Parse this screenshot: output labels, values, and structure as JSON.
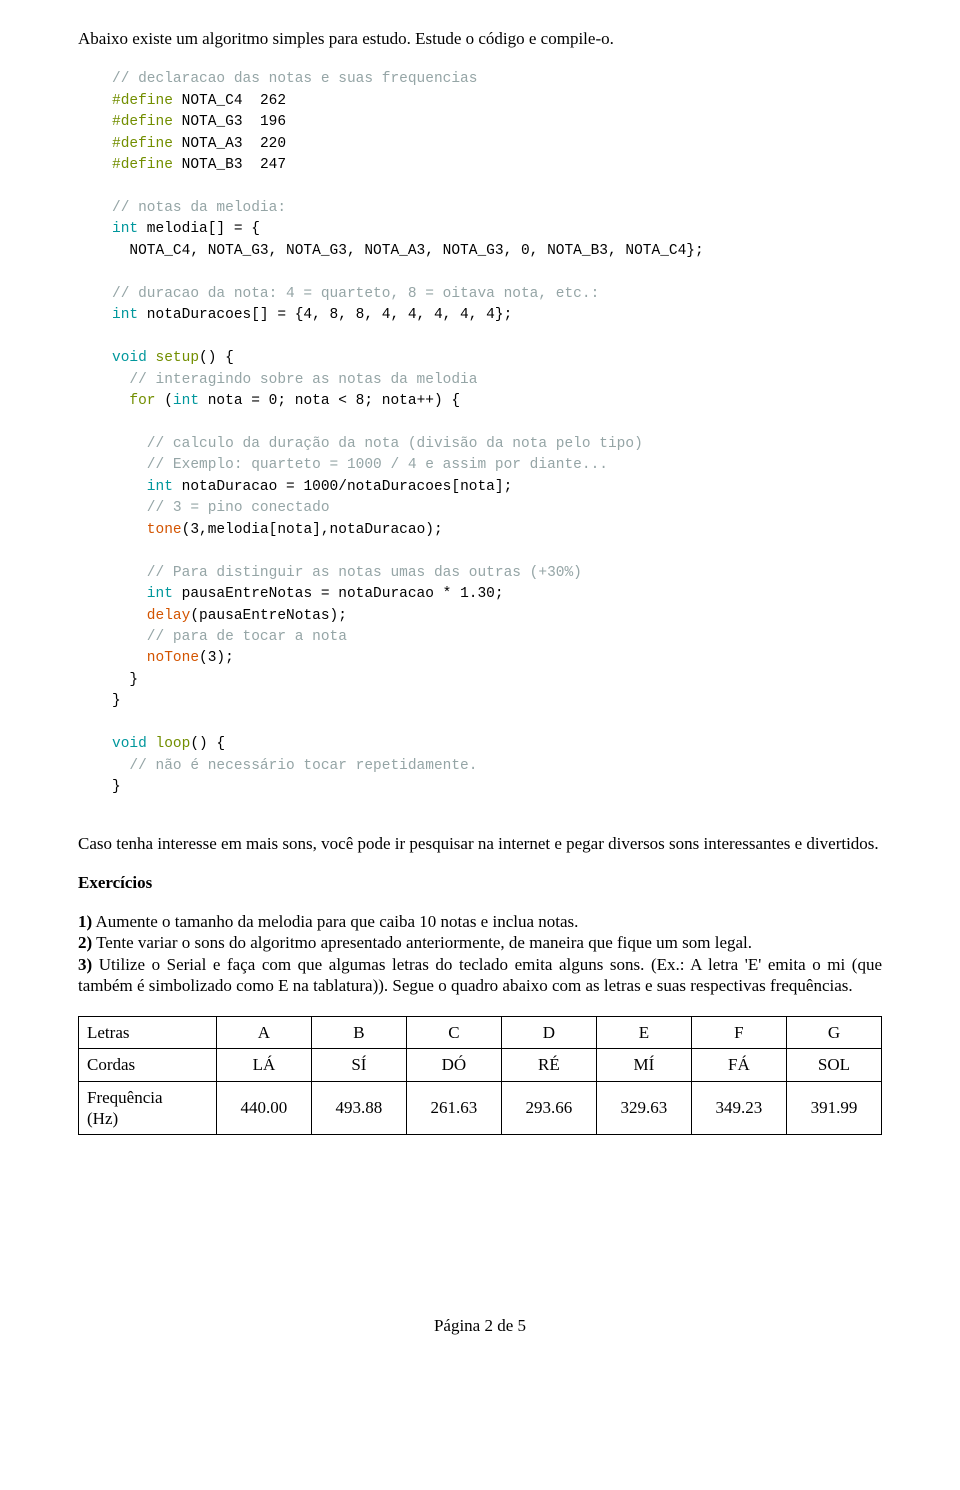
{
  "intro": "Abaixo existe um algoritmo simples para estudo. Estude o código e compile-o.",
  "code": {
    "c1": "// declaracao das notas e suas frequencias",
    "d1a": "#define",
    "d1b": "NOTA_C4  262",
    "d2a": "#define",
    "d2b": "NOTA_G3  196",
    "d3a": "#define",
    "d3b": "NOTA_A3  220",
    "d4a": "#define",
    "d4b": "NOTA_B3  247",
    "c2": "// notas da melodia:",
    "l5a": "int",
    "l5b": " melodia[] = {",
    "l6": "  NOTA_C4, NOTA_G3, NOTA_G3, NOTA_A3, NOTA_G3, 0, NOTA_B3, NOTA_C4};",
    "c3": "// duracao da nota: 4 = quarteto, 8 = oitava nota, etc.:",
    "l7a": "int",
    "l7b": " notaDuracoes[] = {4, 8, 8, 4, 4, 4, 4, 4};",
    "l8a": "void",
    "l8b": "setup",
    "l8c": "() {",
    "c4": "  // interagindo sobre as notas da melodia",
    "l9a": "  for",
    "l9b": " (",
    "l9c": "int",
    "l9d": " nota = 0; nota < 8; nota++) {",
    "c5": "    // calculo da duração da nota (divisão da nota pelo tipo)",
    "c6": "    // Exemplo: quarteto = 1000 / 4 e assim por diante...",
    "l10a": "    int",
    "l10b": " notaDuracao = 1000/notaDuracoes[nota];",
    "c7": "    // 3 = pino conectado",
    "l11a": "    tone",
    "l11b": "(3,melodia[nota],notaDuracao);",
    "c8": "    // Para distinguir as notas umas das outras (+30%)",
    "l12a": "    int",
    "l12b": " pausaEntreNotas = notaDuracao * 1.30;",
    "l13a": "    delay",
    "l13b": "(pausaEntreNotas);",
    "c9": "    // para de tocar a nota",
    "l14a": "    noTone",
    "l14b": "(3);",
    "l15": "  }",
    "l16": "}",
    "l17a": "void",
    "l17b": "loop",
    "l17c": "() {",
    "c10": "  // não é necessário tocar repetidamente.",
    "l18": "}"
  },
  "para2": "Caso tenha interesse em mais sons, você pode ir pesquisar na internet e pegar diversos sons interessantes e divertidos.",
  "sectionTitle": "Exercícios",
  "ex": {
    "n1": "1)",
    "t1": " Aumente o tamanho da melodia para que caiba 10 notas e inclua notas.",
    "n2": "2)",
    "t2": " Tente variar o sons do algoritmo apresentado anteriormente, de maneira que fique um som legal.",
    "n3": "3)",
    "t3": " Utilize o Serial e faça com que algumas letras do teclado emita alguns sons. (Ex.: A letra 'E' emita o mi (que também é simbolizado como E na tablatura)). Segue o quadro abaixo com as letras e suas respectivas frequências."
  },
  "table": {
    "rows": [
      [
        "Letras",
        "A",
        "B",
        "C",
        "D",
        "E",
        "F",
        "G"
      ],
      [
        "Cordas",
        "LÁ",
        "SÍ",
        "DÓ",
        "RÉ",
        "MÍ",
        "FÁ",
        "SOL"
      ],
      [
        "Frequência\n(Hz)",
        "440.00",
        "493.88",
        "261.63",
        "293.66",
        "329.63",
        "349.23",
        "391.99"
      ]
    ]
  },
  "footer": "Página 2 de 5",
  "chart_data": {
    "type": "table",
    "title": "Letras / Cordas / Frequência (Hz)",
    "columns": [
      "Letras",
      "A",
      "B",
      "C",
      "D",
      "E",
      "F",
      "G"
    ],
    "rows": [
      {
        "label": "Cordas",
        "values": [
          "LÁ",
          "SÍ",
          "DÓ",
          "RÉ",
          "MÍ",
          "FÁ",
          "SOL"
        ]
      },
      {
        "label": "Frequência (Hz)",
        "values": [
          440.0,
          493.88,
          261.63,
          293.66,
          329.63,
          349.23,
          391.99
        ]
      }
    ]
  }
}
